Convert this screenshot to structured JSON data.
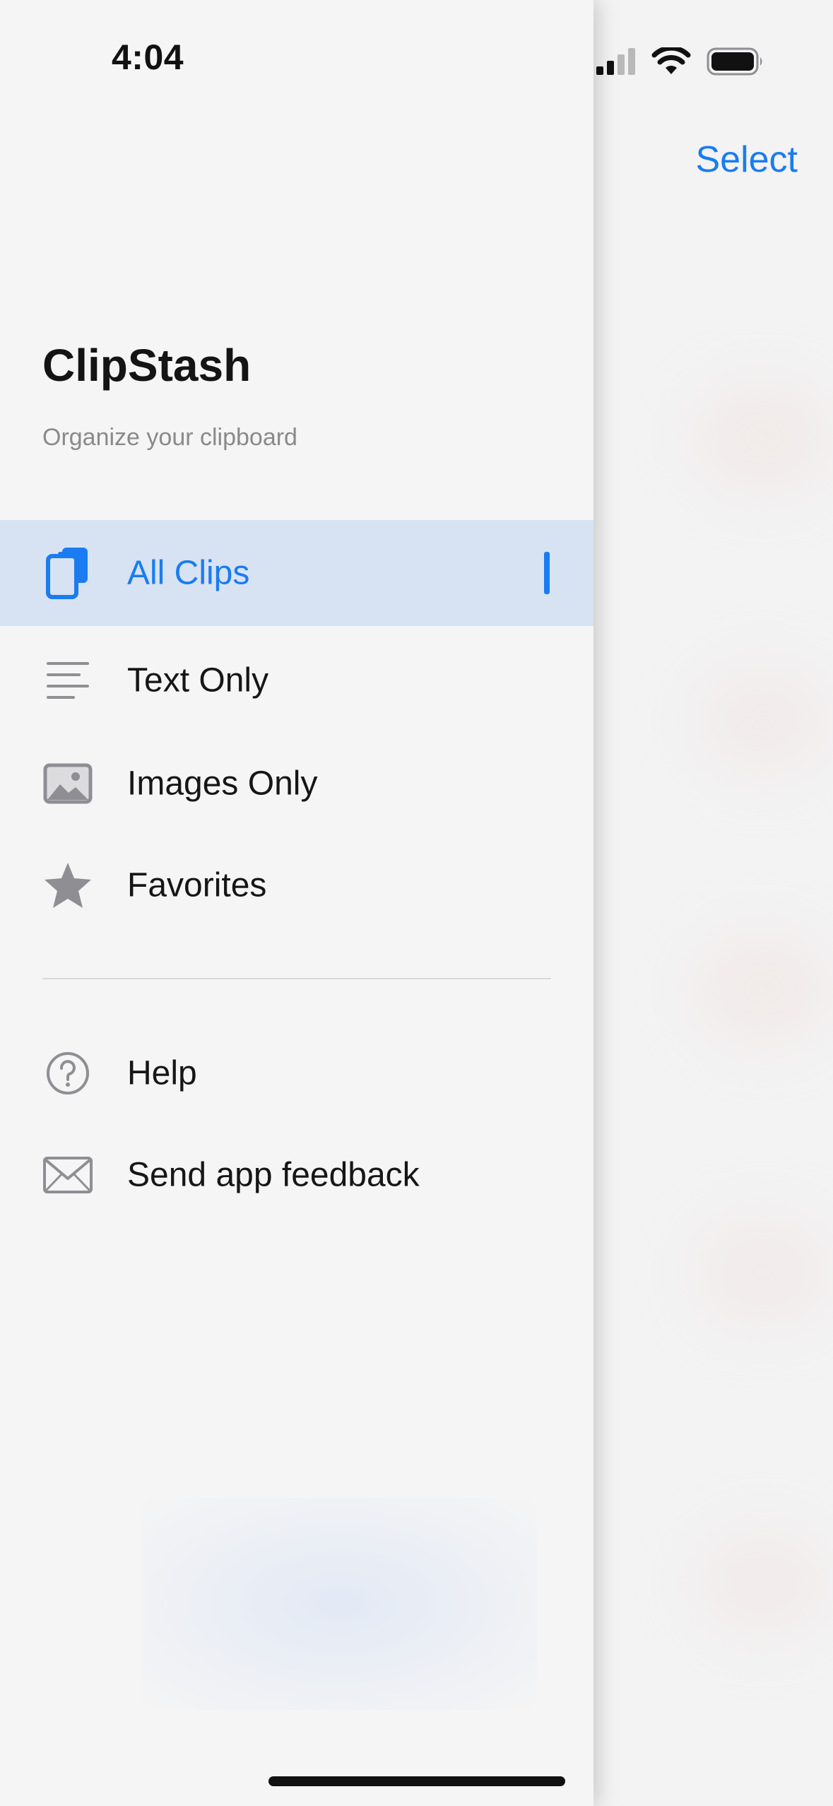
{
  "status_bar": {
    "time": "4:04"
  },
  "background_screen": {
    "select_label": "Select"
  },
  "drawer": {
    "title": "ClipStash",
    "subtitle": "Organize your clipboard",
    "primary_items": [
      {
        "label": "All Clips",
        "icon": "clipboard-icon",
        "active": true
      },
      {
        "label": "Text Only",
        "icon": "text-lines-icon",
        "active": false
      },
      {
        "label": "Images Only",
        "icon": "image-icon",
        "active": false
      },
      {
        "label": "Favorites",
        "icon": "star-icon",
        "active": false
      }
    ],
    "secondary_items": [
      {
        "label": "Help",
        "icon": "help-circle-icon"
      },
      {
        "label": "Send app feedback",
        "icon": "envelope-icon"
      }
    ]
  },
  "colors": {
    "accent": "#1a7cf0",
    "active_row": "#d7e3f2",
    "icon_gray": "#8e8e93",
    "text": "#161616",
    "subtitle": "#8a8a8a"
  }
}
